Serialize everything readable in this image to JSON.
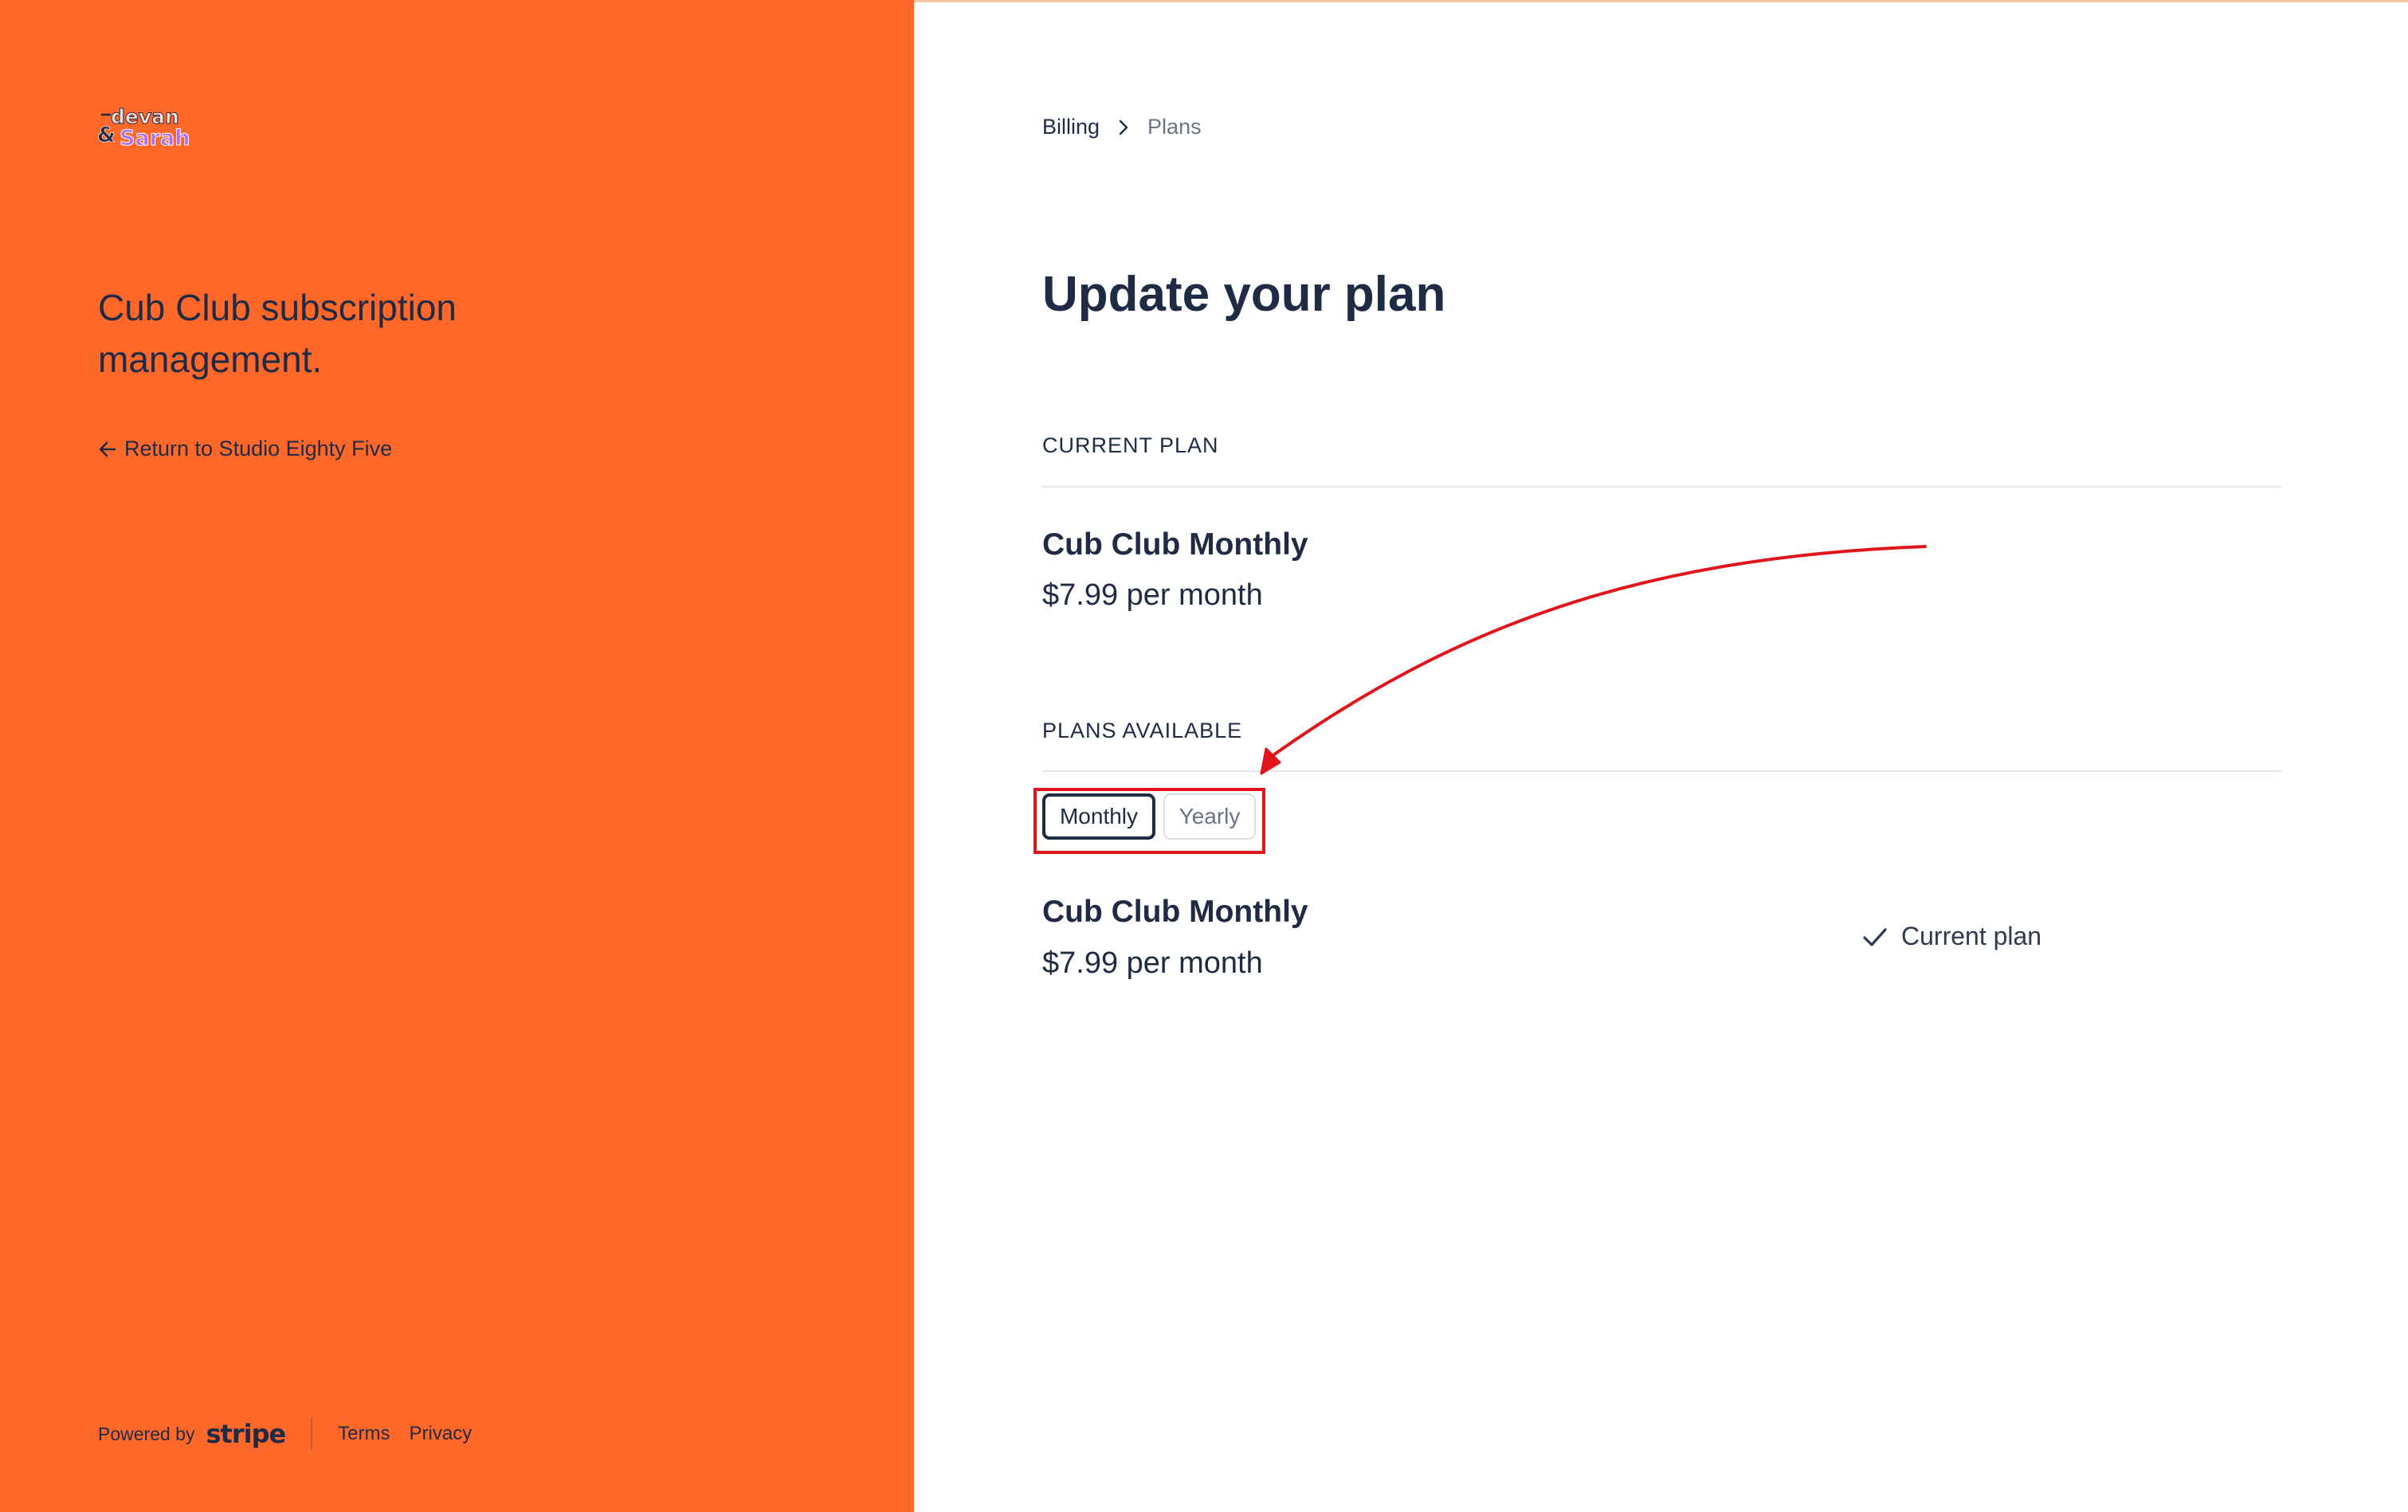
{
  "brand": {
    "logo_text_top": "devan",
    "logo_text_amp": "&",
    "logo_text_bottom": "Sarah",
    "sidebar_color": "#ff6829",
    "text_color": "#1f2a44"
  },
  "sidebar": {
    "title": "Cub Club subscription management.",
    "return_link": "Return to Studio Eighty Five",
    "footer": {
      "powered_by": "Powered by",
      "stripe_logo": "stripe",
      "terms": "Terms",
      "privacy": "Privacy"
    }
  },
  "breadcrumb": {
    "billing": "Billing",
    "plans": "Plans"
  },
  "main": {
    "title": "Update your plan",
    "current_plan": {
      "section_label": "CURRENT PLAN",
      "name": "Cub Club Monthly",
      "price": "$7.99 per month"
    },
    "plans_available": {
      "section_label": "PLANS AVAILABLE",
      "interval_options": [
        "Monthly",
        "Yearly"
      ],
      "selected_interval": "Monthly",
      "plans": [
        {
          "name": "Cub Club Monthly",
          "price": "$7.99 per month",
          "status": "Current plan"
        }
      ]
    }
  },
  "icons": {
    "return": "arrow-left-icon",
    "breadcrumb_separator": "chevron-right-icon",
    "current_plan": "check-icon"
  },
  "annotation": {
    "color": "#e0141a"
  }
}
